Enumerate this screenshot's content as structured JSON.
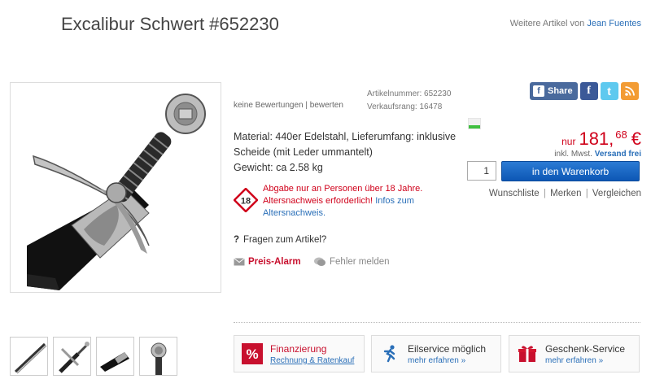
{
  "header": {
    "title": "Excalibur Schwert #652230",
    "more_by_prefix": "Weitere Artikel von",
    "more_by_author": "Jean Fuentes"
  },
  "product": {
    "reviews_text": "keine Bewertungen | bewerten",
    "article_number": "Artikelnummer: 652230",
    "sales_rank": "Verkaufsrang: 16478",
    "description_lines": [
      "Material: 440er Edelstahl, Lieferumfang: inklusive",
      "Scheide (mit Leder ummantelt)",
      "Gewicht: ca 2.58 kg"
    ],
    "age_badge": "18",
    "age_notice": "Abgabe nur an Personen über 18 Jahre. Altersnachweis erforderlich!",
    "age_link": "Infos zum Altersnachweis.",
    "question_icon": "?",
    "question": "Fragen zum Artikel?",
    "price_alarm": "Preis-Alarm",
    "report_error": "Fehler melden"
  },
  "share": {
    "share_label": "Share",
    "facebook": "f",
    "twitter": "t",
    "rss": "rss"
  },
  "price": {
    "prefix": "nur",
    "main": "181,",
    "cents": "68",
    "currency": "€",
    "tax_text": "inkl. Mwst.",
    "shipping_link": "Versand frei",
    "quantity": "1",
    "cart_button": "in den Warenkorb",
    "wishlist": "Wunschliste",
    "remember": "Merken",
    "compare": "Vergleichen",
    "sep": "|"
  },
  "services": [
    {
      "title": "Finanzierung",
      "subtitle": "Rechnung & Ratenkauf",
      "icon": "percent-icon"
    },
    {
      "title": "Eilservice möglich",
      "subtitle": "mehr erfahren »",
      "icon": "running-man-icon"
    },
    {
      "title": "Geschenk-Service",
      "subtitle": "mehr erfahren »",
      "icon": "gift-icon"
    }
  ],
  "colors": {
    "accent_red": "#d0021b",
    "link_blue": "#2a6fb8",
    "cart_blue": "#0d57b5"
  }
}
